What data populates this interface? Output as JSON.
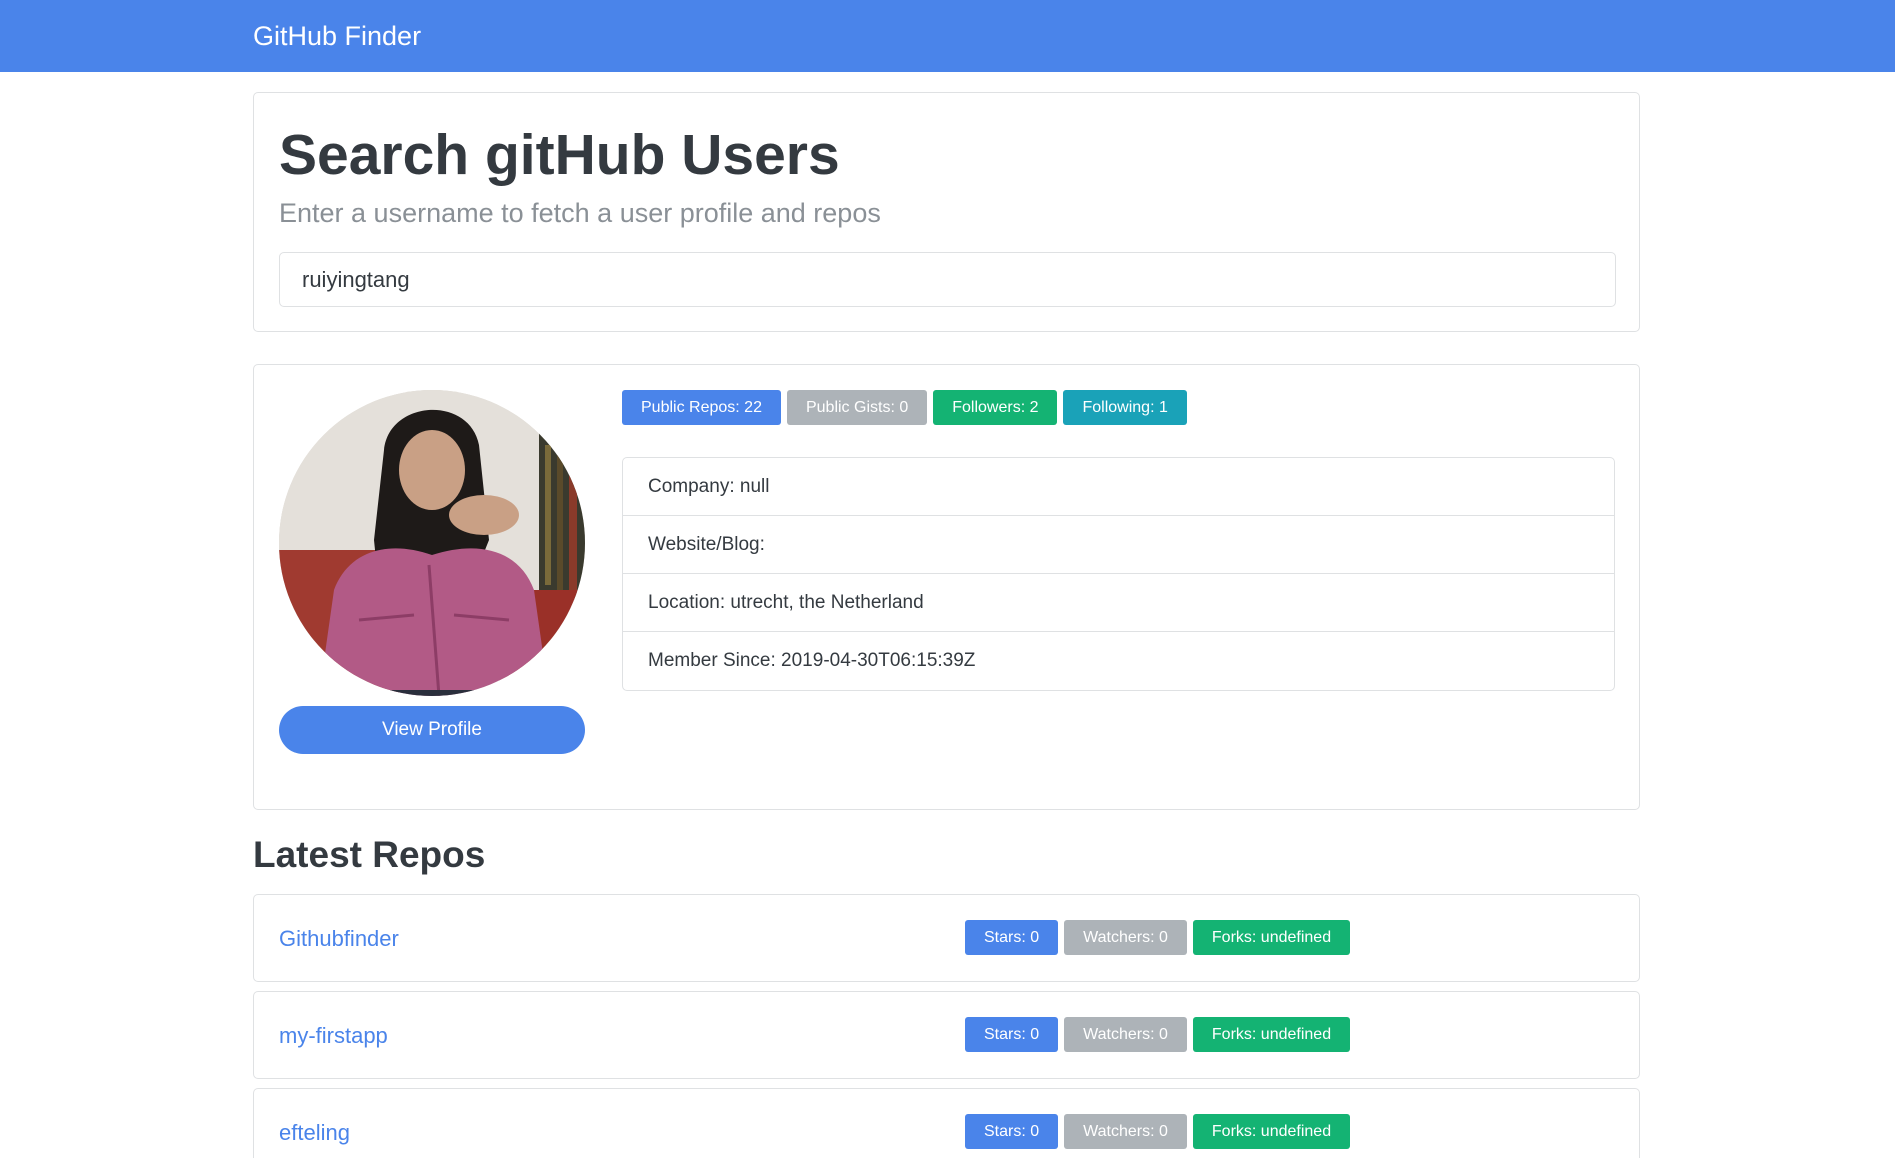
{
  "navbar": {
    "brand": "GitHub Finder"
  },
  "search": {
    "title": "Search gitHub Users",
    "lead": "Enter a username to fetch a user profile and repos",
    "value": "ruiyingtang"
  },
  "user": {
    "view_profile_label": "View Profile",
    "badges": {
      "public_repos": "Public Repos: 22",
      "public_gists": "Public Gists: 0",
      "followers": "Followers: 2",
      "following": "Following: 1"
    },
    "info": {
      "company": "Company: null",
      "website": "Website/Blog:",
      "location": "Location: utrecht, the Netherland",
      "member_since": "Member Since: 2019-04-30T06:15:39Z"
    }
  },
  "repos": {
    "heading": "Latest Repos",
    "items": [
      {
        "name": "Githubfinder",
        "stars": "Stars: 0",
        "watchers": "Watchers: 0",
        "forks": "Forks: undefined"
      },
      {
        "name": "my-firstapp",
        "stars": "Stars: 0",
        "watchers": "Watchers: 0",
        "forks": "Forks: undefined"
      },
      {
        "name": "efteling",
        "stars": "Stars: 0",
        "watchers": "Watchers: 0",
        "forks": "Forks: undefined"
      }
    ]
  },
  "colors": {
    "primary": "#4a84ea",
    "secondary": "#adb3b8",
    "success": "#14b373",
    "info": "#1aa2b8"
  }
}
